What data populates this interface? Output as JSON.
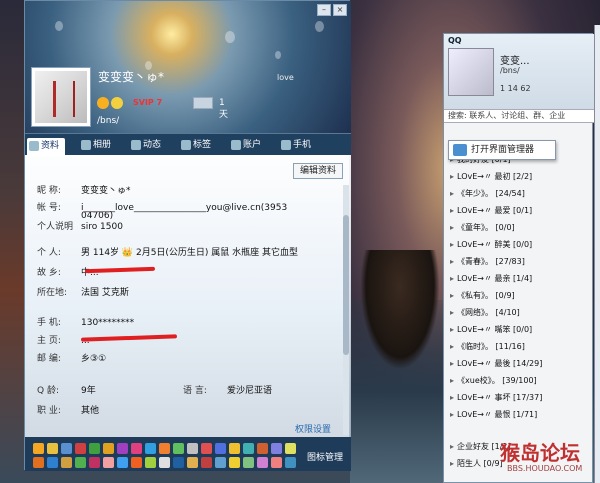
{
  "profile": {
    "nickname": "变变变丶ゅ*",
    "banner_love": "love",
    "svip": "SVIP 7",
    "days": "1天",
    "signature_short": "/bns/",
    "tabs": [
      {
        "label": "资料"
      },
      {
        "label": "相册"
      },
      {
        "label": "动态"
      },
      {
        "label": "标签"
      },
      {
        "label": "账户"
      },
      {
        "label": "手机"
      }
    ],
    "edit_label": "编辑资料",
    "fields": [
      {
        "key": "昵    称:",
        "value": "变变变丶ゅ*"
      },
      {
        "key": "帐    号:",
        "value": "i_______love________________you@live.cn(3953"
      },
      {
        "key": "",
        "value": "04706)"
      },
      {
        "key": "个人说明",
        "value": "siro 1500"
      },
      {
        "key": "个    人:",
        "value": "男   114岁   👑 2月5日(公历生日)  属鼠   水瓶座   其它血型"
      },
      {
        "key": "故    乡:",
        "value": "中..."
      },
      {
        "key": "所在地:",
        "value": "法国 艾克斯"
      },
      {
        "key": "手    机:",
        "value": "130********"
      },
      {
        "key": "主    页:",
        "value": "..."
      },
      {
        "key": "邮    编:",
        "value": "乡③①"
      },
      {
        "key": "Q     龄:",
        "value": "9年"
      },
      {
        "key": "职    业:",
        "value": "其他"
      }
    ],
    "language_key": "语    言:",
    "language_value": "爱沙尼亚语",
    "permissions_link": "权限设置",
    "icon_manager": "图标管理"
  },
  "qq": {
    "title": "QQ",
    "nickname": "变变...",
    "signature": "/bns/",
    "status": "1  14  62",
    "search_placeholder": "搜索: 联系人、讨论组、群、企业",
    "popup": "打开界面管理器",
    "groups": [
      "我的好友  [0/1]",
      "LOvE→〃  最初  [2/2]",
      "《年少》。 [24/54]",
      "LOvE→〃  最爱  [0/1]",
      "《童年》。 [0/0]",
      "LOvE→〃  醉美  [0/0]",
      "《青春》。 [27/83]",
      "LOvE→〃  最亲  [1/4]",
      "《私有》。 [0/9]",
      "《网络》。 [4/10]",
      "LOvE→〃  嘴笨  [0/0]",
      "《临时》。 [11/16]",
      "LOvE→〃  最後  [14/29]",
      "《xue校》。 [39/100]",
      "LOvE→〃  事坏  [17/37]",
      "LOvE→〃  最恨  [1/71]",
      "企业好友  [1/1]",
      "陌生人  [0/9]"
    ]
  },
  "watermark": {
    "text": "猴岛论坛",
    "url": "BBS.HOUDAO.COM"
  }
}
